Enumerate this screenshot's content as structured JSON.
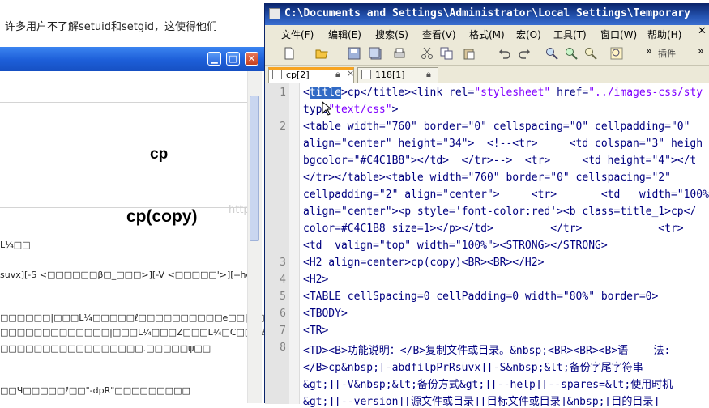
{
  "background_page": {
    "top_text": "许多用户不了解setuid和setgid，这使得他们"
  },
  "browser": {
    "heading_cp": "cp",
    "heading_copy": "cp(copy)",
    "lines": [
      "L¼□□",
      "suvx][-S <□□□□□□β□_□□□>][-V <□□□□□'>][--hel",
      "□□□□□□|□□□L¼□□□□□ℓ□□□□□□□□□□e□□|□□□L¼",
      "□□□□□□□□□□□□□|□□□L¼□□□Z□□□L¼□C□□□ℓ□□□",
      "□□□□□□□□□□□□□□□□□.□□□□□ψ□□",
      "□□Ч□□□□□ℓ□□\"-dpR\"□□□□□□□□□"
    ],
    "watermark": "http"
  },
  "npp": {
    "title": "C:\\Documents and Settings\\Administrator\\Local Settings\\Temporary",
    "menu": [
      "文件(F)",
      "编辑(E)",
      "搜索(S)",
      "查看(V)",
      "格式(M)",
      "宏(O)",
      "工具(T)",
      "窗口(W)",
      "帮助(H)"
    ],
    "plugins_label": "插件",
    "tabs": [
      {
        "label": "cp[2]",
        "active": true
      },
      {
        "label": "118[1]",
        "active": false
      }
    ],
    "line_numbers": [
      "1",
      "2",
      "3",
      "4",
      "5",
      "6",
      "7",
      "8"
    ],
    "code": {
      "l1a_sel": "title",
      "l1a_rest": ">cp</title><link rel=",
      "l1a_str": "\"stylesheet\"",
      "l1a_rest2": " href=",
      "l1a_str2": "\"../images-css/sty",
      "l1b_pre": "type",
      "l1b_str": "\"text/css\"",
      "l1b_post": ">",
      "l2a": "<table width=\"760\" border=\"0\" cellspacing=\"0\" cellpadding=\"0\"",
      "l2b": "align=\"center\" height=\"34\">  <!--<tr>     <td colspan=\"3\" heigh",
      "l2c": "bgcolor=\"#C4C1B8\"></td>  </tr>-->  <tr>     <td height=\"4\"></t",
      "l2d": "</tr></table><table width=\"760\" border=\"0\" cellspacing=\"2\"",
      "l2e": "cellpadding=\"2\" align=\"center\">     <tr>       <td   width=\"100%",
      "l2f": "align=\"center\"><p style='font-color:red'><b class=title_1>cp</",
      "l2g": "color=#C4C1B8 size=1></p></td>         </tr>            <tr>",
      "l2h": "<td  valign=\"top\" width=\"100%\"><STRONG></STRONG>",
      "l3": "<H2 align=center>cp(copy)<BR><BR></H2>",
      "l4": "<H2>",
      "l5": "<TABLE cellSpacing=0 cellPadding=0 width=\"80%\" border=0>",
      "l6": "<TBODY>",
      "l7": "<TR>",
      "l8a": "<TD><B>功能说明：</B>复制文件或目录。&nbsp;<BR><BR><B>语    法:",
      "l8b": "</B>cp&nbsp;[-abdfilpPrRsuvx][-S&nbsp;&lt;备份字尾字符串",
      "l8c": "&gt;][-V&nbsp;&lt;备份方式&gt;][--help][--spares=&lt;使用时机",
      "l8d": "&gt;][--version][源文件或目录][目标文件或目录]&nbsp;[目的目录]"
    }
  }
}
